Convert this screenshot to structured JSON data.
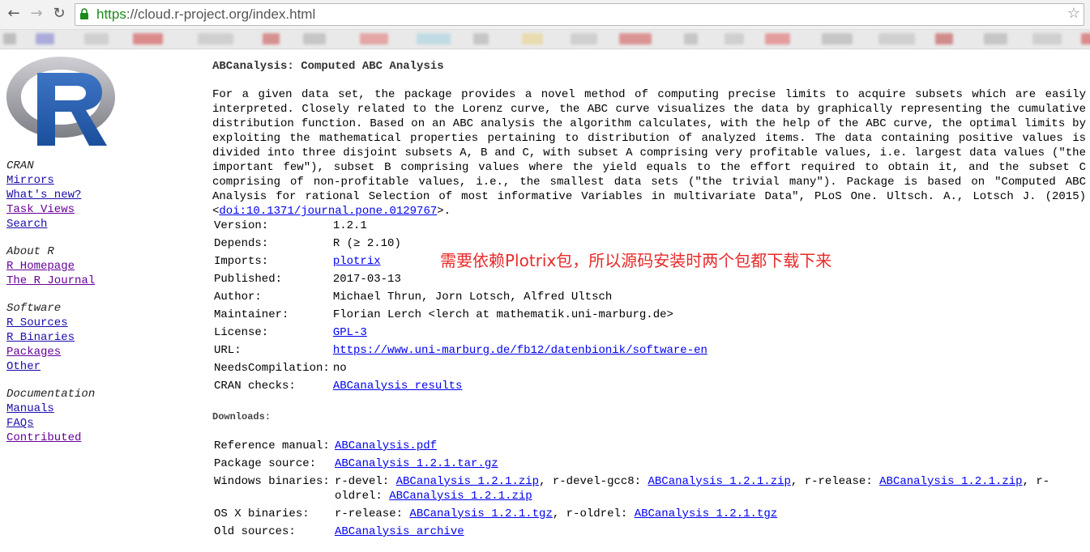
{
  "browser": {
    "url_scheme": "https",
    "url_rest": "://cloud.r-project.org/index.html",
    "bookmark_colors": [
      "#9c9c9c",
      "#7a7ad0",
      "#bbbbbb",
      "#d04040",
      "#bbbbbb",
      "#c84848",
      "#aaaaaa",
      "#e07070",
      "#9fd0e0",
      "#aaaaaa",
      "#e8d080",
      "#bbbbbb",
      "#d05050",
      "#aaaaaa",
      "#bbbbbb",
      "#e06060",
      "#aaaaaa",
      "#bbbbbb",
      "#c04040",
      "#aaaaaa",
      "#bbbbbb",
      "#d04040",
      "#aaaaaa",
      "#bbbbbb"
    ]
  },
  "sidebar": {
    "groups": [
      {
        "heading": "CRAN",
        "links": [
          "Mirrors",
          "What's new?",
          "Task Views",
          "Search"
        ]
      },
      {
        "heading": "About R",
        "links": [
          "R Homepage",
          "The R Journal"
        ]
      },
      {
        "heading": "Software",
        "links": [
          "R Sources",
          "R Binaries",
          "Packages",
          "Other"
        ]
      },
      {
        "heading": "Documentation",
        "links": [
          "Manuals",
          "FAQs",
          "Contributed"
        ]
      }
    ]
  },
  "package": {
    "title": "ABCanalysis: Computed ABC Analysis",
    "description": "For a given data set, the package provides a novel method of computing precise limits to acquire subsets which are easily interpreted. Closely related to the Lorenz curve, the ABC curve visualizes the data by graphically representing the cumulative distribution function. Based on an ABC analysis the algorithm calculates, with the help of the ABC curve, the optimal limits by exploiting the mathematical properties pertaining to distribution of analyzed items. The data containing positive values is divided into three disjoint subsets A, B and C, with subset A comprising very profitable values, i.e. largest data values (\"the important few\"), subset B comprising values where the yield equals to the effort required to obtain it, and the subset C comprising of non-profitable values, i.e., the smallest data sets (\"the trivial many\"). Package is based on \"Computed ABC Analysis for rational Selection of most informative Variables in multivariate Data\", PLoS One. Ultsch. A., Lotsch J. (2015) <",
    "doi_link": "doi:10.1371/journal.pone.0129767",
    "description_end": ">.",
    "details": {
      "version_label": "Version:",
      "version": "1.2.1",
      "depends_label": "Depends:",
      "depends": "R (≥ 2.10)",
      "imports_label": "Imports:",
      "imports": "plotrix",
      "published_label": "Published:",
      "published": "2017-03-13",
      "author_label": "Author:",
      "author": "Michael Thrun, Jorn Lotsch, Alfred Ultsch",
      "maintainer_label": "Maintainer:",
      "maintainer": "Florian Lerch <lerch at mathematik.uni-marburg.de>",
      "license_label": "License:",
      "license": "GPL-3",
      "url_label": "URL:",
      "url": "https://www.uni-marburg.de/fb12/datenbionik/software-en",
      "needs_label": "NeedsCompilation:",
      "needs": "no",
      "checks_label": "CRAN checks:",
      "checks": "ABCanalysis results"
    },
    "downloads": {
      "heading": "Downloads:",
      "ref_label": "Reference manual:",
      "ref_link": "ABCanalysis.pdf",
      "src_label": "Package source:",
      "src_link": "ABCanalysis_1.2.1.tar.gz",
      "win_label": "Windows binaries:",
      "win_devel": "r-devel: ",
      "win_devel_link": "ABCanalysis_1.2.1.zip",
      "win_gcc8": ", r-devel-gcc8: ",
      "win_gcc8_link": "ABCanalysis_1.2.1.zip",
      "win_release": ", r-release: ",
      "win_release_link": "ABCanalysis_1.2.1.zip",
      "win_oldrel": ", r-oldrel: ",
      "win_oldrel_link": "ABCanalysis_1.2.1.zip",
      "osx_label": "OS X binaries:",
      "osx_release": "r-release: ",
      "osx_release_link": "ABCanalysis_1.2.1.tgz",
      "osx_oldrel": ", r-oldrel: ",
      "osx_oldrel_link": "ABCanalysis_1.2.1.tgz",
      "old_label": "Old sources:",
      "old_link": "ABCanalysis archive"
    }
  },
  "annotation": "需要依赖Plotrix包，所以源码安装时两个包都下载下来"
}
